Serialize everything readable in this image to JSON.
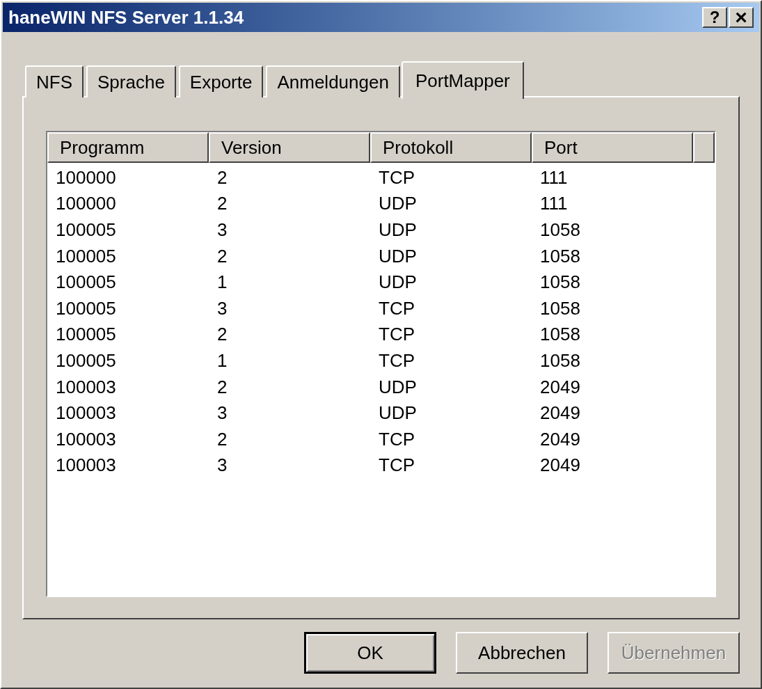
{
  "window": {
    "title": "haneWIN NFS Server 1.1.34"
  },
  "title_buttons": [
    {
      "kind": "help",
      "label": "?"
    },
    {
      "kind": "close",
      "label": "×"
    }
  ],
  "tabs": [
    {
      "label": "NFS",
      "selected": false
    },
    {
      "label": "Sprache",
      "selected": false
    },
    {
      "label": "Exporte",
      "selected": false
    },
    {
      "label": "Anmeldungen",
      "selected": false
    },
    {
      "label": "PortMapper",
      "selected": true
    }
  ],
  "table": {
    "columns": [
      "Programm",
      "Version",
      "Protokoll",
      "Port"
    ],
    "rows": [
      [
        "100000",
        "2",
        "TCP",
        "111"
      ],
      [
        "100000",
        "2",
        "UDP",
        "111"
      ],
      [
        "100005",
        "3",
        "UDP",
        "1058"
      ],
      [
        "100005",
        "2",
        "UDP",
        "1058"
      ],
      [
        "100005",
        "1",
        "UDP",
        "1058"
      ],
      [
        "100005",
        "3",
        "TCP",
        "1058"
      ],
      [
        "100005",
        "2",
        "TCP",
        "1058"
      ],
      [
        "100005",
        "1",
        "TCP",
        "1058"
      ],
      [
        "100003",
        "2",
        "UDP",
        "2049"
      ],
      [
        "100003",
        "3",
        "UDP",
        "2049"
      ],
      [
        "100003",
        "2",
        "TCP",
        "2049"
      ],
      [
        "100003",
        "3",
        "TCP",
        "2049"
      ]
    ]
  },
  "buttons": [
    {
      "label": "OK",
      "default": true,
      "disabled": false
    },
    {
      "label": "Abbrechen",
      "default": false,
      "disabled": false
    },
    {
      "label": "Übernehmen",
      "default": false,
      "disabled": true
    }
  ]
}
